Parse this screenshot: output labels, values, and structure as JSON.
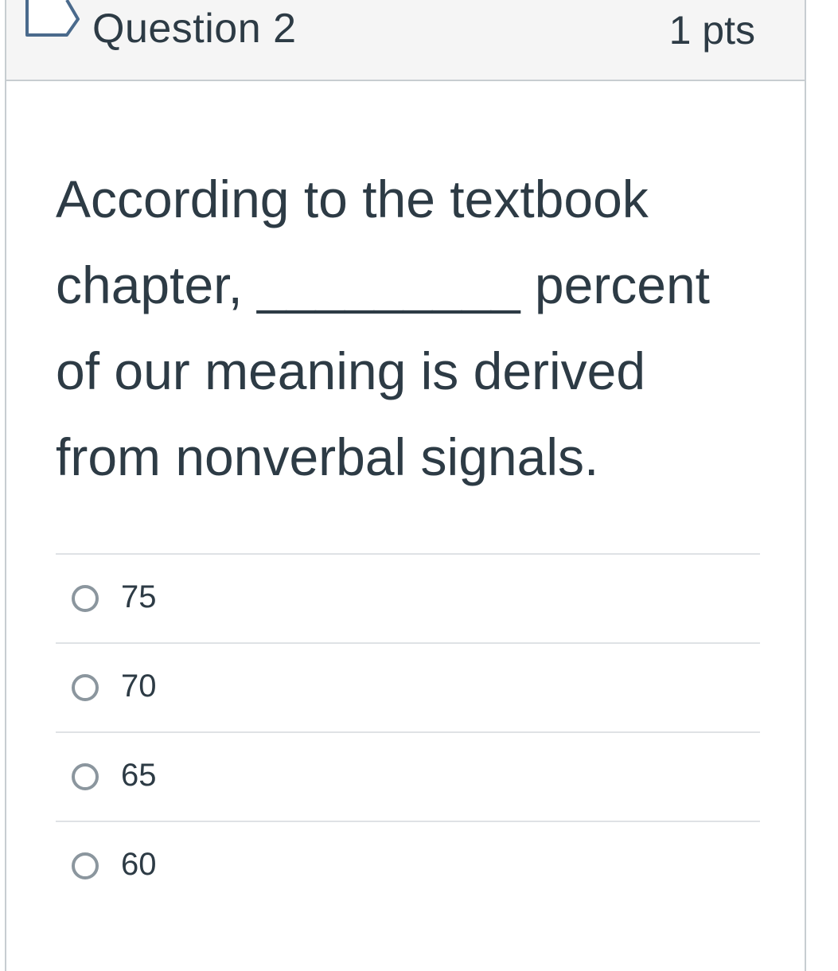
{
  "question": {
    "title": "Question 2",
    "points": "1 pts",
    "text": "According to the textbook chapter, _________ percent of our meaning is derived from nonverbal signals.",
    "flag_icon": "flag-outline-icon"
  },
  "answers": [
    {
      "label": "75",
      "selected": false
    },
    {
      "label": "70",
      "selected": false
    },
    {
      "label": "65",
      "selected": false
    },
    {
      "label": "60",
      "selected": false
    }
  ],
  "colors": {
    "text": "#2d3b45",
    "header_bg": "#f5f5f5",
    "border": "#c7cdd1",
    "divider": "#dfe2e5",
    "radio_border": "#8b969e"
  }
}
